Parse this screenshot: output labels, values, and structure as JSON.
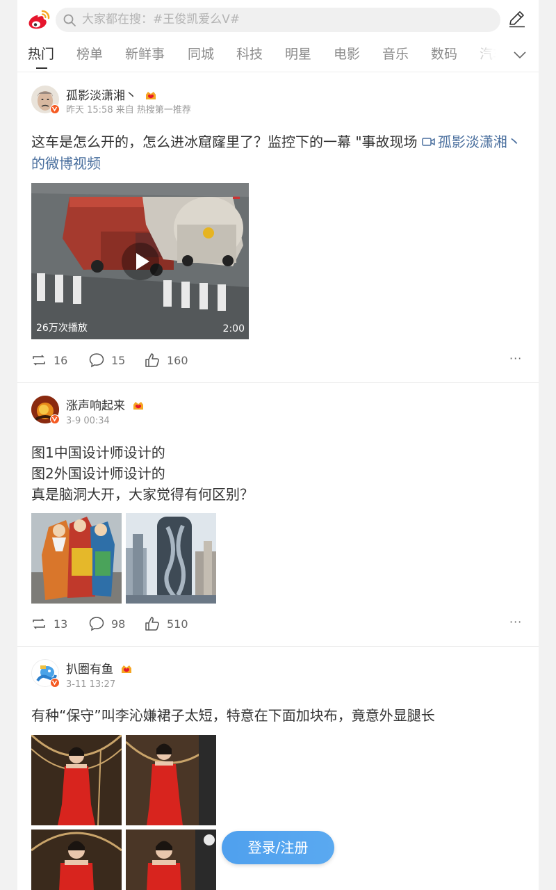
{
  "search": {
    "placeholder": "大家都在搜：#王俊凯爱么V#"
  },
  "tabs": [
    "热门",
    "榜单",
    "新鲜事",
    "同城",
    "科技",
    "明星",
    "电影",
    "音乐",
    "数码",
    "汽车"
  ],
  "active_tab": "热门",
  "posts": [
    {
      "user": "孤影淡潇湘丶",
      "meta": "昨天 15:58 来自 热搜第一推荐",
      "text": "这车是怎么开的，怎么进冰窟窿里了？监控下的一幕 \"事故现场 ",
      "link_text": "孤影淡潇湘丶的微博视频",
      "video": {
        "play_count": "26万次播放",
        "duration": "2:00"
      },
      "reposts": "16",
      "comments": "15",
      "likes": "160",
      "more": "···"
    },
    {
      "user": "涨声响起来",
      "meta": "3-9 00:34",
      "text_lines": [
        "图1中国设计师设计的",
        "图2外国设计师设计的",
        "真是脑洞大开，大家觉得有何区别？"
      ],
      "reposts": "13",
      "comments": "98",
      "likes": "510",
      "more": "···"
    },
    {
      "user": "扒圈有鱼",
      "meta": "3-11 13:27",
      "text": "有种“保守”叫李沁嫌裙子太短，特意在下面加块布，竟意外显腿长"
    }
  ],
  "login_button": "登录/注册",
  "colors": {
    "link": "#4a6f9e",
    "login_button": "#52a4ef",
    "verified_badge": "#f55a22",
    "weibo_red": "#e6162d"
  }
}
